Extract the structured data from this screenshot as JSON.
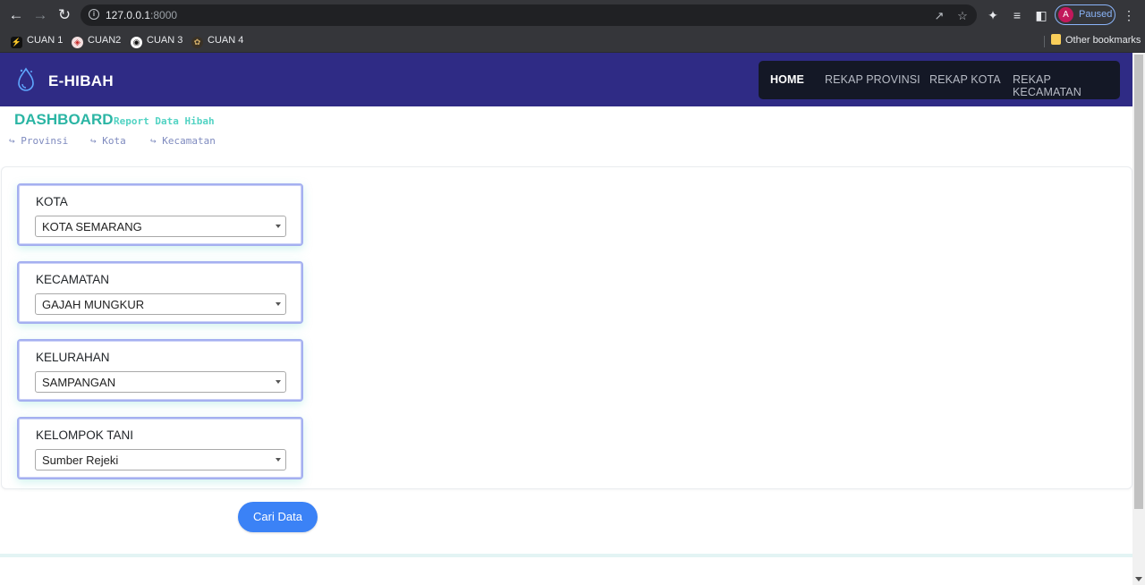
{
  "browser": {
    "url_host": "127.0.0.1",
    "url_port": ":8000",
    "profile_initial": "A",
    "profile_status": "Paused",
    "bookmarks": [
      {
        "label": "CUAN 1",
        "icon": "lightning-icon",
        "color": "#111111"
      },
      {
        "label": "CUAN2",
        "icon": "shield-icon",
        "color": "#c62828"
      },
      {
        "label": "CUAN 3",
        "icon": "circle-logo-icon",
        "color": "#ffffff"
      },
      {
        "label": "CUAN 4",
        "icon": "badge-icon",
        "color": "#b08d57"
      }
    ],
    "other_bookmarks": "Other bookmarks"
  },
  "nav": {
    "brand": "E-HIBAH",
    "items": [
      {
        "label": "HOME",
        "active": true
      },
      {
        "label": "REKAP PROVINSI",
        "active": false
      },
      {
        "label": "REKAP KOTA",
        "active": false
      },
      {
        "label": "REKAP KECAMATAN",
        "active": false
      }
    ],
    "bg_color": "#2f2b85",
    "menu_bg_color": "#141826"
  },
  "header": {
    "title": "DASHBOARD",
    "subtitle": "Report Data Hibah",
    "title_color": "#2bb5a4"
  },
  "breadcrumbs": [
    {
      "arrow": "↪",
      "label": "Provinsi"
    },
    {
      "arrow": "↪",
      "label": "Kota"
    },
    {
      "arrow": "↪",
      "label": "Kecamatan"
    }
  ],
  "form": {
    "fields": [
      {
        "label": "KOTA",
        "value": "KOTA SEMARANG"
      },
      {
        "label": "KECAMATAN",
        "value": "GAJAH MUNGKUR"
      },
      {
        "label": "KELURAHAN",
        "value": "SAMPANGAN"
      },
      {
        "label": "KELOMPOK TANI",
        "value": "Sumber Rejeki"
      }
    ],
    "submit_label": "Cari Data",
    "submit_color": "#3b82f6"
  }
}
